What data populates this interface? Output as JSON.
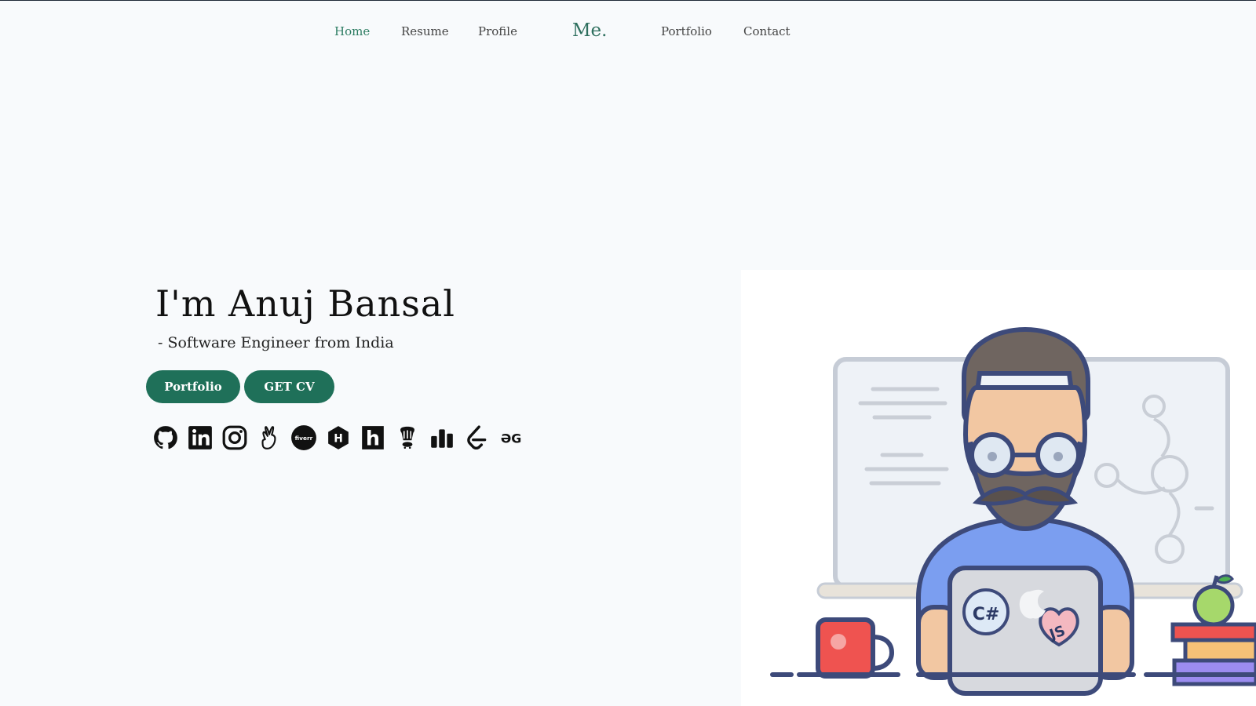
{
  "nav": {
    "home": "Home",
    "resume": "Resume",
    "profile": "Profile",
    "brand": "Me.",
    "portfolio": "Portfolio",
    "contact": "Contact",
    "active": "Home"
  },
  "hero": {
    "title": "I'm Anuj Bansal",
    "subtitle": "- Software Engineer from India",
    "buttons": {
      "portfolio": "Portfolio",
      "cv": "GET CV"
    }
  },
  "social_icons": [
    "github-icon",
    "linkedin-icon",
    "instagram-icon",
    "angellist-icon",
    "fiverr-icon",
    "hackerrank-icon",
    "hackerearth-icon",
    "codechef-icon",
    "codeforces-icon",
    "leetcode-icon",
    "geeksforgeeks-icon"
  ],
  "social_labels": {
    "fiverr": "fiverr",
    "hackerrank": "H",
    "hackerearth": "h",
    "geeksforgeeks": "ƏG"
  },
  "illustration": {
    "sticker_csharp": "C#",
    "sticker_js": "JS"
  },
  "colors": {
    "accent": "#1f7059",
    "active_link": "#2e7d63",
    "background": "#f8fafc",
    "shirt": "#7b9ef0",
    "mug": "#ef5350"
  }
}
